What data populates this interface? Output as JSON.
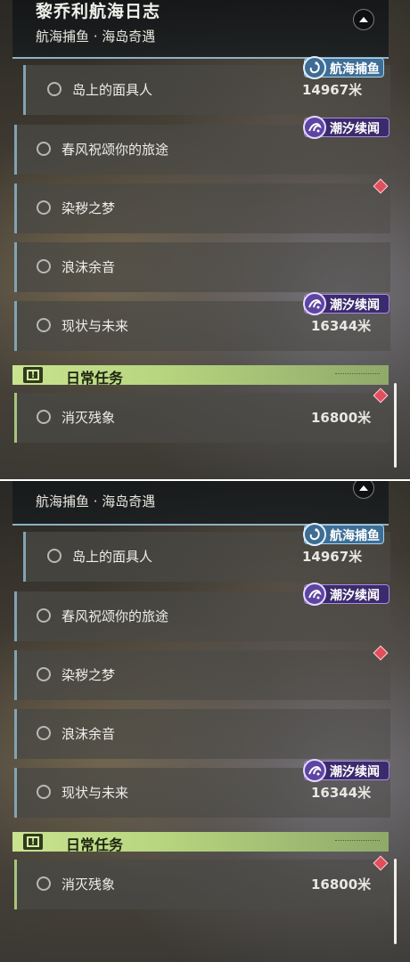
{
  "header": {
    "title": "黎乔利航海日志",
    "subtitle": "航海捕鱼 · 海岛奇遇"
  },
  "tags": {
    "fishing": "航海捕鱼",
    "tide": "潮汐续闻"
  },
  "quests": [
    {
      "title": "岛上的面具人",
      "distance": "14967米",
      "tag": "fishing"
    },
    {
      "title": "春风祝颂你的旅途",
      "distance": "",
      "tag": "tide"
    },
    {
      "title": "染秽之梦",
      "distance": "",
      "tag": "",
      "marker": "red-diamond"
    },
    {
      "title": "浪沫余音",
      "distance": "",
      "tag": ""
    },
    {
      "title": "现状与未来",
      "distance": "16344米",
      "tag": "tide"
    }
  ],
  "daily": {
    "label": "日常任务",
    "quests": [
      {
        "title": "消灭残象",
        "distance": "16800米",
        "marker": "red-diamond"
      }
    ]
  },
  "colors": {
    "accent_blue": "#82a3b3",
    "daily_green": "#c9e38f",
    "tide_purple": "#5e44a3",
    "fishing_blue": "#3d6e96",
    "marker_red": "#e0505c"
  }
}
